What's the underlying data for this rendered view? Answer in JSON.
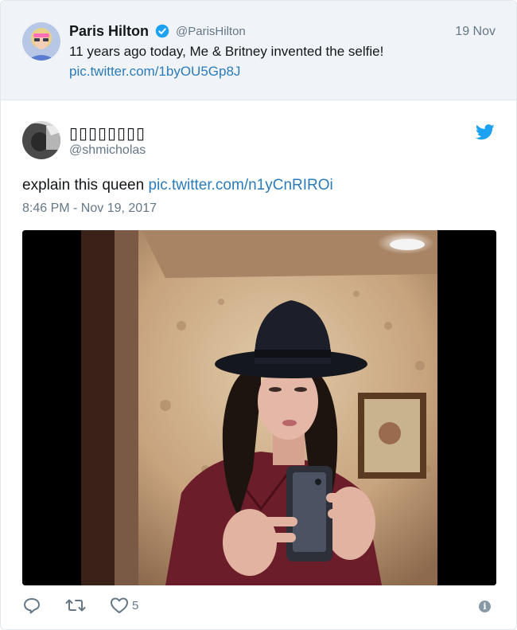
{
  "quoted_tweet": {
    "author_name": "Paris Hilton",
    "handle": "@ParisHilton",
    "date": "19 Nov",
    "text": "11 years ago today, Me & Britney invented the selfie!",
    "link": "pic.twitter.com/1byOU5Gp8J",
    "verified": true
  },
  "tweet": {
    "author_name": "▯▯▯▯▯▯▯▯",
    "handle": "@shmicholas",
    "text": "explain this queen",
    "link": "pic.twitter.com/n1yCnRIROi",
    "timestamp": "8:46 PM - Nov 19, 2017"
  },
  "actions": {
    "like_count": "5"
  },
  "icons": {
    "reply": "reply-icon",
    "retweet": "retweet-icon",
    "like": "heart-icon",
    "info": "info-icon",
    "brand": "twitter-bird-icon"
  },
  "colors": {
    "link": "#2b7bb9",
    "muted": "#657786",
    "twitter_blue": "#1da1f2",
    "verified": "#1da1f2",
    "quoted_bg": "#f0f4f8"
  }
}
